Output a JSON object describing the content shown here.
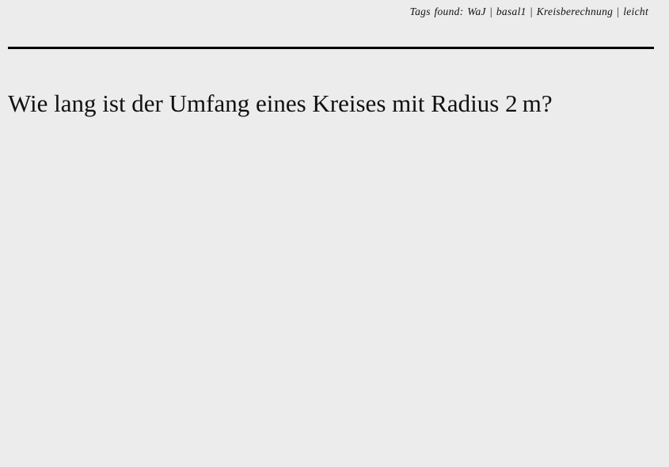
{
  "tags": {
    "prefix": "Tags found:",
    "items": [
      "WaJ",
      "basal1",
      "Kreisberechnung",
      "leicht"
    ],
    "separator": "|"
  },
  "question": "Wie lang ist der Umfang eines Kreises mit Radius 2 m?"
}
